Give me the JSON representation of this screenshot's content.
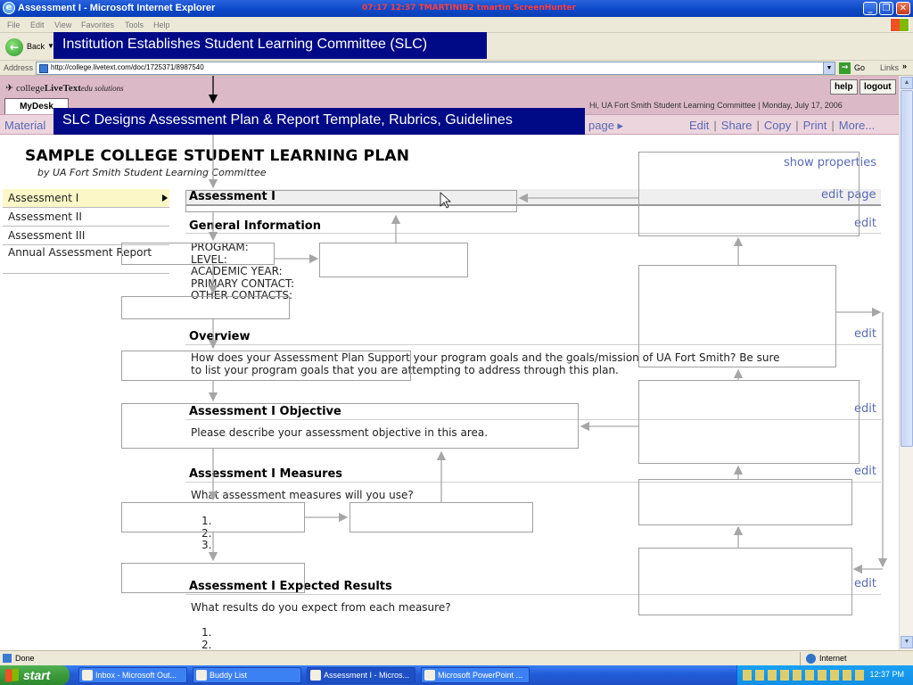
{
  "window": {
    "title": "Assessment I - Microsoft Internet Explorer",
    "recorder_text": "07:17  12:37  TMARTINIB2  tmartin  ScreenHunter",
    "ie_icon": "e"
  },
  "menu": [
    "File",
    "Edit",
    "View",
    "Favorites",
    "Tools",
    "Help"
  ],
  "toolbar": {
    "back_label": "Back"
  },
  "address": {
    "label": "Address",
    "url": "http://college.livetext.com/doc/1725371/8987540",
    "go_label": "Go",
    "links_label": "Links"
  },
  "site": {
    "logo_prefix": "college",
    "logo_brand": "LiveText",
    "logo_suffix": "edu solutions",
    "help_label": "help",
    "logout_label": "logout",
    "mydesk_tab": "MyDesk",
    "greeting": "Hi, UA Fort Smith Student Learning Committee  |  Monday, July 17, 2006"
  },
  "nav": {
    "left": "Material",
    "page_crumb": "page ▸",
    "actions": [
      "Edit",
      "Share",
      "Copy",
      "Print",
      "More..."
    ]
  },
  "doc": {
    "title": "SAMPLE COLLEGE STUDENT LEARNING PLAN",
    "byline": "by UA Fort Smith Student Learning Committee",
    "show_properties": "show properties",
    "edit_page": "edit page",
    "edit_label": "edit"
  },
  "side_nav": [
    "Assessment I",
    "Assessment II",
    "Assessment III",
    "Annual Assessment Report"
  ],
  "sections": {
    "current": "Assessment I",
    "general_info": {
      "heading": "General Information",
      "lines": [
        "PROGRAM:",
        "LEVEL:",
        "ACADEMIC YEAR:",
        "PRIMARY CONTACT:",
        "OTHER CONTACTS:"
      ]
    },
    "overview": {
      "heading": "Overview",
      "line1": "How does your Assessment Plan Support your program goals and the goals/mission of UA Fort Smith?   Be sure",
      "line2": "to list your program goals that you are attempting to address through this plan."
    },
    "objective": {
      "heading": "Assessment I Objective",
      "text": "Please describe your assessment objective in this area."
    },
    "measures": {
      "heading": "Assessment I Measures",
      "text": "What assessment measures will you use?",
      "items": [
        "1.",
        "2.",
        "3."
      ]
    },
    "results": {
      "heading": "Assessment I Expected Results",
      "text": "What results do you expect from each measure?",
      "items": [
        "1.",
        "2."
      ]
    }
  },
  "callouts": {
    "first": "Institution Establishes Student Learning Committee (SLC)",
    "second": "SLC Designs Assessment Plan & Report Template, Rubrics, Guidelines"
  },
  "status": {
    "text": "Done",
    "zone": "Internet"
  },
  "taskbar": {
    "start": "start",
    "tasks": [
      "Inbox - Microsoft Out...",
      "Buddy List",
      "Assessment I - Micros...",
      "Microsoft PowerPoint ..."
    ],
    "clock": "12:37 PM"
  },
  "colors": {
    "callout_bg": "#000a86",
    "header_pink": "#dcb9c7",
    "link_blue": "#5a6ab4"
  }
}
